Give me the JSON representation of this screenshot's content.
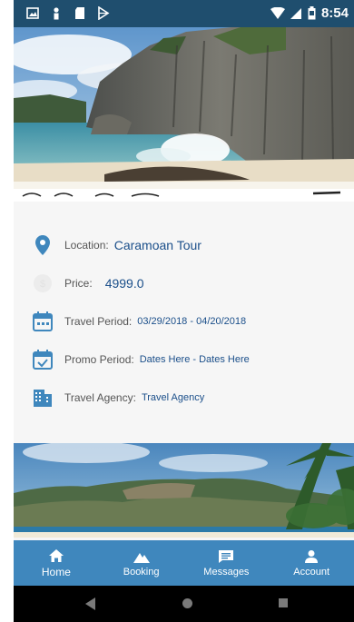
{
  "status_bar": {
    "time": "8:54",
    "icons": [
      "gallery-icon",
      "person-icon",
      "sd-card-icon",
      "play-store-icon",
      "wifi-icon",
      "signal-icon",
      "battery-icon"
    ]
  },
  "tour": {
    "location_label": "Location:",
    "location_value": "Caramoan Tour",
    "price_label": "Price:",
    "price_value": "4999.0",
    "travel_period_label": "Travel Period:",
    "travel_period_value": "03/29/2018 - 04/20/2018",
    "promo_period_label": "Promo Period:",
    "promo_period_value": "Dates Here - Dates Here",
    "travel_agency_label": "Travel Agency:",
    "travel_agency_value": "Travel Agency"
  },
  "nav": {
    "items": [
      {
        "label": "Home",
        "icon": "home-icon",
        "active": true
      },
      {
        "label": "Booking",
        "icon": "mountain-icon",
        "active": false
      },
      {
        "label": "Messages",
        "icon": "message-icon",
        "active": false
      },
      {
        "label": "Account",
        "icon": "person-icon",
        "active": false
      }
    ]
  },
  "system_bar": {
    "buttons": [
      "back-icon",
      "home-circle-icon",
      "recents-icon"
    ]
  },
  "colors": {
    "status_bar": "#1f4e6e",
    "accent": "#3f87bd",
    "value_text": "#1b4f8a"
  }
}
